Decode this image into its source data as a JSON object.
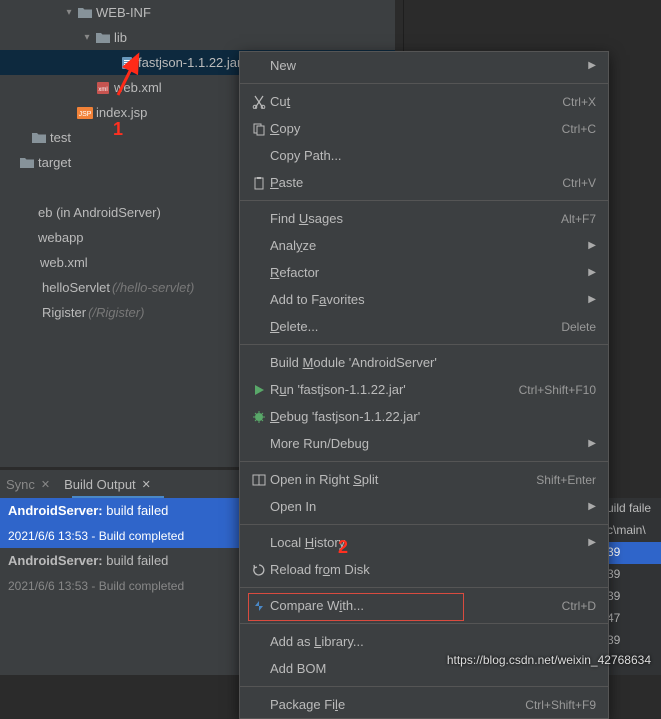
{
  "tree": {
    "rows": [
      {
        "indent": 58,
        "chev": "▾",
        "icon": "folder",
        "label": "WEB-INF"
      },
      {
        "indent": 76,
        "chev": "▾",
        "icon": "folder",
        "label": "lib"
      },
      {
        "indent": 100,
        "chev": "",
        "icon": "jar",
        "label": "fastjson-1.1.22.jar",
        "selected": true
      },
      {
        "indent": 76,
        "chev": "",
        "icon": "xml",
        "label": "web.xml"
      },
      {
        "indent": 58,
        "chev": "",
        "icon": "jsp",
        "label": "index.jsp"
      },
      {
        "indent": 12,
        "chev": "",
        "icon": "folder",
        "label": "test"
      },
      {
        "indent": 0,
        "chev": "",
        "icon": "folder",
        "label": "target"
      },
      {
        "indent": 0,
        "chev": "",
        "icon": "",
        "label": ""
      },
      {
        "indent": 0,
        "chev": "",
        "icon": "",
        "label": "eb (in AndroidServer)"
      },
      {
        "indent": 0,
        "chev": "",
        "icon": "",
        "label": "webapp"
      },
      {
        "indent": 2,
        "chev": "",
        "icon": "",
        "label": "web.xml"
      },
      {
        "indent": 4,
        "chev": "",
        "icon": "",
        "label": "helloServlet",
        "dim": "(/hello-servlet)"
      },
      {
        "indent": 4,
        "chev": "",
        "icon": "",
        "label": "Rigister",
        "dim": "(/Rigister)"
      }
    ]
  },
  "tabs": {
    "items": [
      {
        "label": "Sync",
        "active": false
      },
      {
        "label": "Build Output",
        "active": true
      }
    ]
  },
  "status": {
    "items": [
      {
        "main": "AndroidServer:",
        "tail": " build failed",
        "sub": "2021/6/6 13:53 - Build completed",
        "selected": true
      },
      {
        "main": "AndroidServer:",
        "tail": " build failed",
        "sub": "2021/6/6 13:53 - Build completed",
        "selected": false
      }
    ]
  },
  "right_status": {
    "items": [
      "uild faile",
      "c\\main\\",
      "39",
      "39",
      "39",
      "47",
      "39"
    ]
  },
  "menu": {
    "groups": [
      [
        {
          "icon": "",
          "label": "New",
          "sub": true
        }
      ],
      [
        {
          "icon": "cut",
          "label": "Cut",
          "u": 2,
          "short": "Ctrl+X"
        },
        {
          "icon": "copy",
          "label": "Copy",
          "u": 0,
          "short": "Ctrl+C"
        },
        {
          "icon": "",
          "label": "Copy Path...",
          "u": -1
        },
        {
          "icon": "paste",
          "label": "Paste",
          "u": 0,
          "short": "Ctrl+V"
        }
      ],
      [
        {
          "icon": "",
          "label": "Find Usages",
          "u": 5,
          "short": "Alt+F7"
        },
        {
          "icon": "",
          "label": "Analyze",
          "u": 4,
          "sub": true
        },
        {
          "icon": "",
          "label": "Refactor",
          "u": 0,
          "sub": true
        },
        {
          "icon": "",
          "label": "Add to Favorites",
          "u": 8,
          "sub": true
        },
        {
          "icon": "",
          "label": "Delete...",
          "u": 0,
          "short": "Delete"
        }
      ],
      [
        {
          "icon": "",
          "label": "Build Module 'AndroidServer'",
          "u": 6
        },
        {
          "icon": "run",
          "label": "Run 'fastjson-1.1.22.jar'",
          "u": 1,
          "short": "Ctrl+Shift+F10"
        },
        {
          "icon": "debug",
          "label": "Debug 'fastjson-1.1.22.jar'",
          "u": 0
        },
        {
          "icon": "",
          "label": "More Run/Debug",
          "sub": true
        }
      ],
      [
        {
          "icon": "split",
          "label": "Open in Right Split",
          "u": 14,
          "short": "Shift+Enter"
        },
        {
          "icon": "",
          "label": "Open In",
          "sub": true
        }
      ],
      [
        {
          "icon": "",
          "label": "Local History",
          "u": 6,
          "sub": true
        },
        {
          "icon": "reload",
          "label": "Reload from Disk",
          "u": 9
        }
      ],
      [
        {
          "icon": "compare",
          "label": "Compare With...",
          "u": 9,
          "short": "Ctrl+D"
        }
      ],
      [
        {
          "icon": "",
          "label": "Add as Library...",
          "u": 7
        },
        {
          "icon": "",
          "label": "Add BOM"
        }
      ],
      [
        {
          "icon": "",
          "label": "Package File",
          "u": 10,
          "short": "Ctrl+Shift+F9"
        }
      ]
    ]
  },
  "annotations": {
    "num1": "1",
    "num2": "2"
  },
  "watermark": "https://blog.csdn.net/weixin_42768634"
}
